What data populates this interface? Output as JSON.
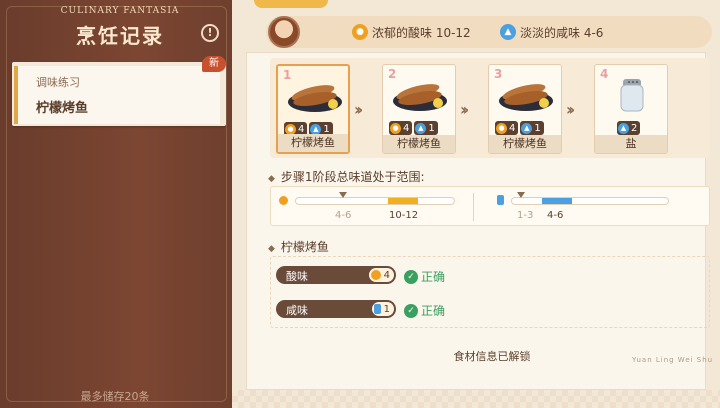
{
  "sidebar": {
    "brand": "CULINARY FANTASIA",
    "title": "烹饪记录",
    "info_icon": "!",
    "entry": {
      "category": "调味练习",
      "name": "柠檬烤鱼",
      "badge": "新"
    },
    "storage_note": "最多储存20条"
  },
  "header": {
    "requirement_sour": "浓郁的酸味 10-12",
    "requirement_salty": "淡淡的咸味 4-6",
    "icons": {
      "sour": "lemon-icon",
      "salty": "salt-shaker-icon"
    }
  },
  "steps": [
    {
      "num": "1",
      "name": "柠檬烤鱼",
      "sour": "4",
      "salty": "1",
      "icon": "grilled-fish-icon"
    },
    {
      "num": "2",
      "name": "柠檬烤鱼",
      "sour": "4",
      "salty": "1",
      "icon": "grilled-fish-icon"
    },
    {
      "num": "3",
      "name": "柠檬烤鱼",
      "sour": "4",
      "salty": "1",
      "icon": "grilled-fish-icon"
    },
    {
      "num": "4",
      "name": "盐",
      "salty": "2",
      "icon": "salt-shaker-icon"
    }
  ],
  "range_section": {
    "title": "步骤1阶段总味道处于范围:",
    "sour": {
      "current": "4-6",
      "target": "10-12"
    },
    "salty": {
      "current": "1-3",
      "target": "4-6"
    }
  },
  "dish_section": {
    "title": "柠檬烤鱼",
    "tastes": [
      {
        "name": "酸味",
        "value": "4",
        "status": "正确"
      },
      {
        "name": "咸味",
        "value": "1",
        "status": "正确"
      }
    ]
  },
  "footer": {
    "unlocked": "食材信息已解锁",
    "stamp": "Yuan Ling Wei Shu"
  },
  "colors": {
    "sour": "#f0a020",
    "salty": "#4aa0e0",
    "correct": "#3aa060",
    "cover": "#7c4632"
  }
}
